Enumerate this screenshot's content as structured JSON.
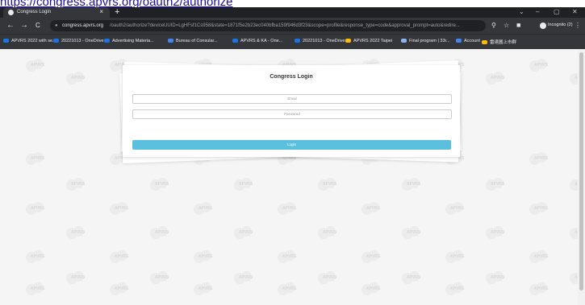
{
  "top_link_text": "https://congress.apvrs.org/oauth2/authorize",
  "browser": {
    "tab_title": "Congress Login",
    "tab_close": "×",
    "new_tab": "+",
    "window_controls": [
      "⌄",
      "–",
      "▢",
      "✕"
    ],
    "nav": {
      "back": "←",
      "forward": "→",
      "reload": "C"
    },
    "url_host": "congress.apvrs.org",
    "url_path": "/oauth2/authorize?deviceUUID=LgHFsf1Cs958&state=1871f5e2b23ec040bfba159f946d3f23&scope=profile&response_type=code&approval_prompt=auto&redire...",
    "incognito_label": "Incognito (2)",
    "bookmarks": [
      {
        "label": "APVRS 2022 with se...",
        "color": "#1a73e8"
      },
      {
        "label": "20221013 - OneDrive",
        "color": "#1a73e8"
      },
      {
        "label": "Advertising Materia...",
        "color": "#1a73e8"
      },
      {
        "label": "Bureau of Consular...",
        "color": "#4285f4"
      },
      {
        "label": "APVRS & KA - One...",
        "color": "#1a73e8"
      },
      {
        "label": "20221013 - OneDrive",
        "color": "#1a73e8"
      },
      {
        "label": "APVRS 2022 Taipei",
        "color": "#fbbc04"
      },
      {
        "label": "Final program | 33r...",
        "color": "#8ab4f8"
      },
      {
        "label": "Account",
        "color": "#4285f4"
      },
      {
        "label": "雷達圖上市群",
        "color": "#fbbc04"
      }
    ]
  },
  "login": {
    "title": "Congress Login",
    "email_placeholder": "Email",
    "password_placeholder": "Password",
    "login_label": "Login",
    "button_color": "#5bc0de"
  },
  "watermark_text": "APVRS"
}
